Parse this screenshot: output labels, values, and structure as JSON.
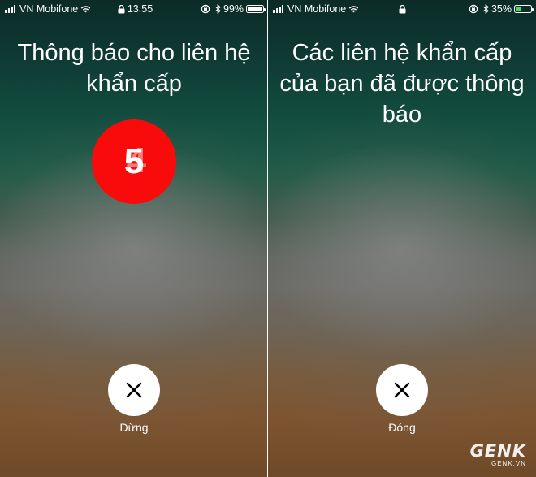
{
  "left_screen": {
    "status_bar": {
      "carrier": "VN Mobifone",
      "time": "13:55",
      "battery_percent": "99%",
      "battery_level": 0.99,
      "battery_color": "#ffffff"
    },
    "title": "Thông báo cho liên hệ khẩn cấp",
    "countdown_value": "5",
    "countdown_ghost": "4",
    "countdown_color": "#f90b0b",
    "action_label": "Dừng",
    "action_icon": "close-icon"
  },
  "right_screen": {
    "status_bar": {
      "carrier": "VN Mobifone",
      "battery_percent": "35%",
      "battery_level": 0.35,
      "battery_color": "#4cd964"
    },
    "title": "Các liên hệ khẩn cấp của bạn đã được thông báo",
    "action_label": "Đóng",
    "action_icon": "close-icon"
  },
  "watermark": {
    "brand": "GENK",
    "domain": "GENK.VN"
  }
}
